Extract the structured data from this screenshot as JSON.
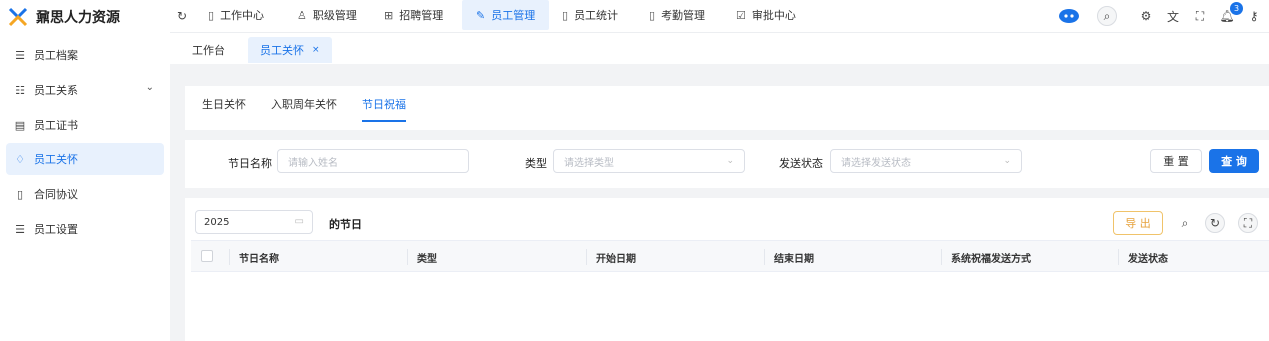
{
  "app": {
    "title": "鼐思人力资源"
  },
  "sidebar": {
    "items": [
      {
        "label": "员工档案",
        "icon": "list-icon"
      },
      {
        "label": "员工关系",
        "icon": "tree-list-icon",
        "expandable": true
      },
      {
        "label": "员工证书",
        "icon": "certificate-icon"
      },
      {
        "label": "员工关怀",
        "icon": "care-icon",
        "active": true
      },
      {
        "label": "合同协议",
        "icon": "document-icon"
      },
      {
        "label": "员工设置",
        "icon": "settings-list-icon"
      }
    ]
  },
  "topnav": {
    "items": [
      {
        "label": "工作中心",
        "icon": "document-icon"
      },
      {
        "label": "职级管理",
        "icon": "hierarchy-icon"
      },
      {
        "label": "招聘管理",
        "icon": "grid-icon"
      },
      {
        "label": "员工管理",
        "icon": "edit-icon",
        "active": true
      },
      {
        "label": "员工统计",
        "icon": "document-icon"
      },
      {
        "label": "考勤管理",
        "icon": "document-icon"
      },
      {
        "label": "审批中心",
        "icon": "checkbox-icon"
      }
    ],
    "notification_count": "3"
  },
  "page_tabs": {
    "home": "工作台",
    "current": "员工关怀",
    "close": "×"
  },
  "subtabs": [
    "生日关怀",
    "入职周年关怀",
    "节日祝福"
  ],
  "filters": {
    "name_label": "节日名称",
    "name_placeholder": "请输入姓名",
    "type_label": "类型",
    "type_placeholder": "请选择类型",
    "status_label": "发送状态",
    "status_placeholder": "请选择发送状态",
    "reset": "重 置",
    "search": "查 询"
  },
  "table": {
    "year": "2025",
    "title": "的节日",
    "export": "导 出",
    "columns": [
      "节日名称",
      "类型",
      "开始日期",
      "结束日期",
      "系统祝福发送方式",
      "发送状态"
    ]
  },
  "colors": {
    "accent": "#1a73e8",
    "warning": "#e6a23c",
    "active_bg": "#e8f1fd"
  }
}
